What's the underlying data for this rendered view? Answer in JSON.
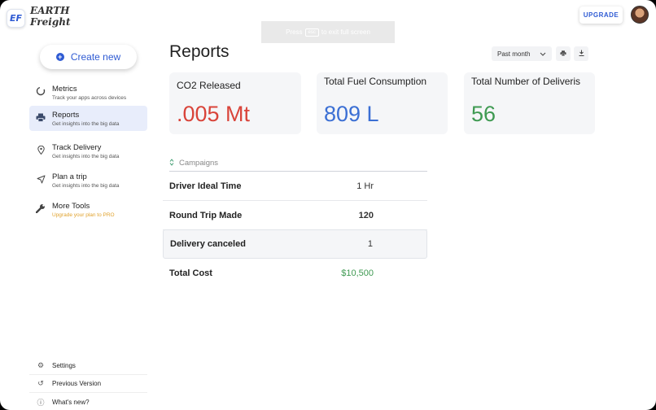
{
  "app": {
    "logo_badge": "EF",
    "logo_line1": "EARTH",
    "logo_line2": "Freight",
    "upgrade_label": "UPGRADE"
  },
  "fullscreen_toast": {
    "pre": "Press",
    "key": "esc",
    "post": "to exit full screen"
  },
  "sidebar": {
    "create_label": "Create new",
    "items": [
      {
        "title": "Metrics",
        "sub": "Track your apps across devices",
        "icon": "metrics-icon"
      },
      {
        "title": "Reports",
        "sub": "Get insights into the big data",
        "icon": "printer-icon"
      },
      {
        "title": "Track Delivery",
        "sub": "Get insights into the big data",
        "icon": "location-pin-icon"
      },
      {
        "title": "Plan a trip",
        "sub": "Get insights into the big data",
        "icon": "navigation-arrow-icon"
      },
      {
        "title": "More Tools",
        "sub": "Upgrade your plan to PRO",
        "icon": "wrench-icon"
      }
    ],
    "bottom": [
      {
        "label": "Settings",
        "icon": "gear-icon"
      },
      {
        "label": "Previous Version",
        "icon": "history-icon"
      },
      {
        "label": "What's new?",
        "icon": "info-icon"
      }
    ]
  },
  "main": {
    "title": "Reports",
    "period": "Past month",
    "cards": [
      {
        "label": "CO2 Released",
        "value": ".005 Mt",
        "color": "#d9443a"
      },
      {
        "label": "Total Fuel Consumption",
        "value": "809 L",
        "color": "#3b6fd4"
      },
      {
        "label": "Total Number of Deliveris",
        "value": "56",
        "color": "#3f9a52"
      }
    ],
    "campaigns_label": "Campaigns",
    "rows": [
      {
        "label": "Driver Ideal Time",
        "value": "1 Hr"
      },
      {
        "label": "Round Trip Made",
        "value": "120"
      },
      {
        "label": "Delivery canceled",
        "value": "1"
      },
      {
        "label": "Total Cost",
        "value": "$10,500",
        "color": "#3f9a52"
      }
    ]
  }
}
